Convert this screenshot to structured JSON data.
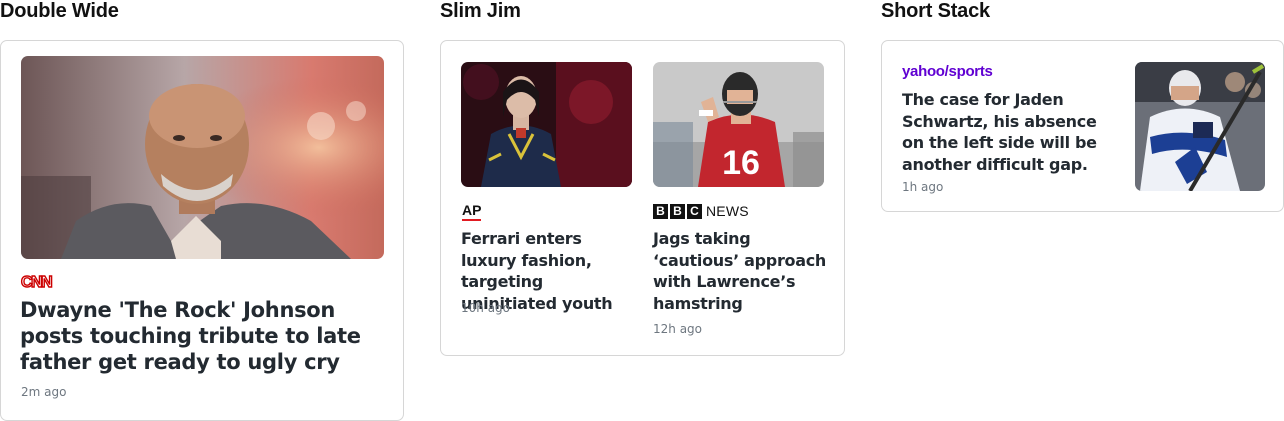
{
  "sections": {
    "double_wide": {
      "title": "Double Wide",
      "source": "CNN",
      "headline": "Dwayne 'The Rock' Johnson posts touching tribute to late father get ready to ugly cry",
      "time": "2m ago"
    },
    "slim_jim": {
      "title": "Slim Jim",
      "articles": [
        {
          "source": "AP",
          "headline": "Ferrari enters luxury fashion, targeting uninitiated youth",
          "time": "10h ago"
        },
        {
          "source_boxes": [
            "B",
            "B",
            "C"
          ],
          "source_suffix": "NEWS",
          "headline": "Jags taking ‘cautious’ approach with Lawrence’s hamstring",
          "time": "12h ago"
        }
      ]
    },
    "short_stack": {
      "title": "Short Stack",
      "source": "yahoo/sports",
      "headline": "The case for Jaden Schwartz, his absence on the left side will be another difficult gap.",
      "time": "1h ago"
    }
  },
  "colors": {
    "cnn_red": "#cc0000",
    "ap_red": "#e11b22",
    "yahoo_purple": "#6001d2",
    "headline": "#232a31",
    "timestamp": "#6e7780",
    "card_border": "#d6d6d6"
  }
}
